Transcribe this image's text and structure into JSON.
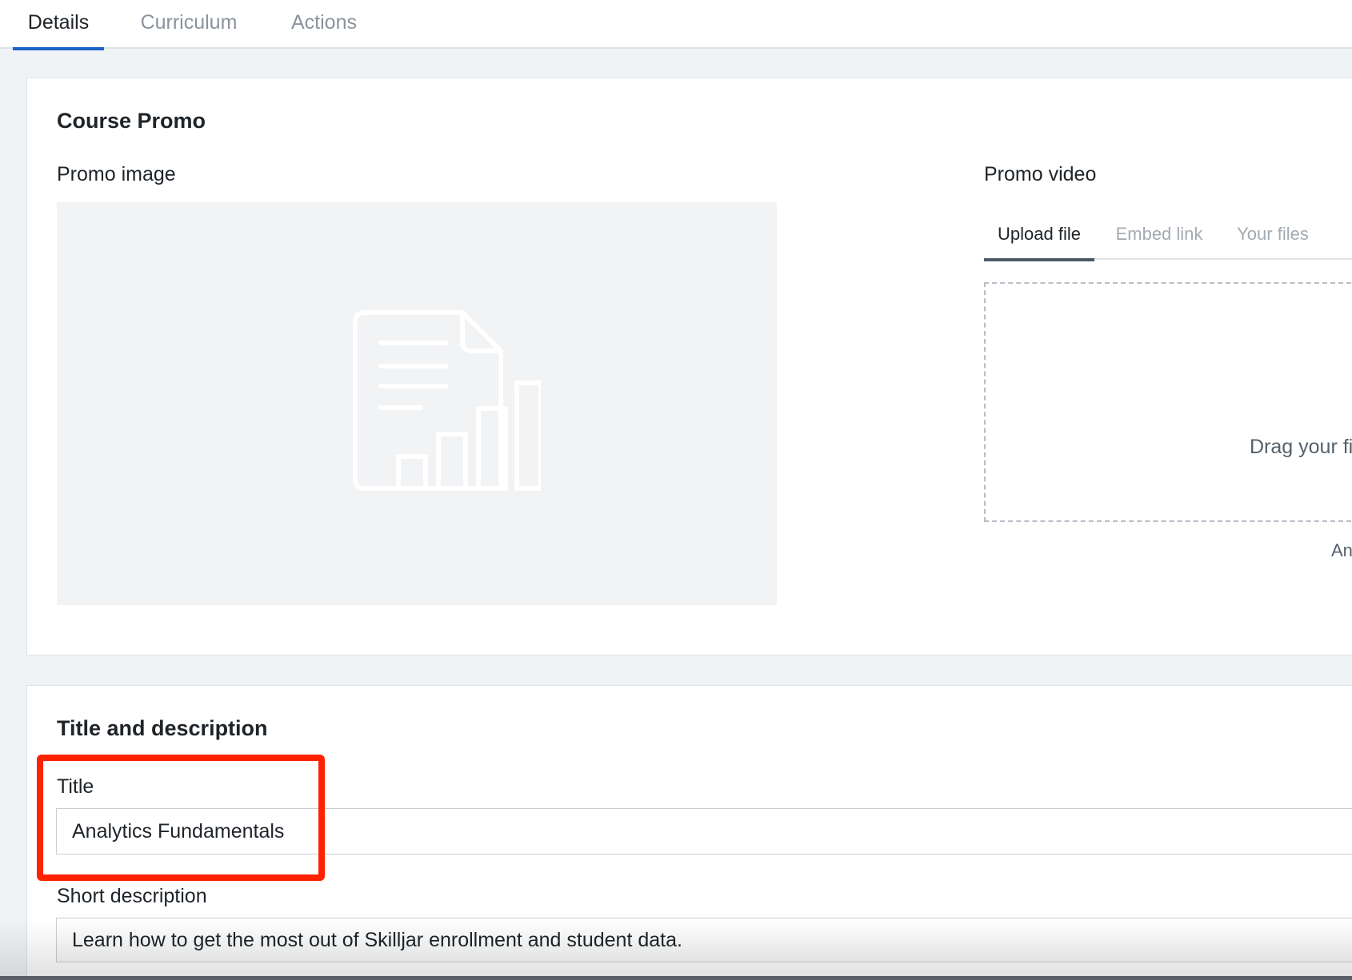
{
  "tabs": [
    {
      "label": "Details",
      "active": true
    },
    {
      "label": "Curriculum",
      "active": false
    },
    {
      "label": "Actions",
      "active": false
    }
  ],
  "course_promo": {
    "heading": "Course Promo",
    "promo_image_label": "Promo image",
    "promo_image_icon": "document-chart-icon",
    "promo_video_label": "Promo video",
    "video_tabs": [
      {
        "label": "Upload file",
        "active": true
      },
      {
        "label": "Embed link",
        "active": false
      },
      {
        "label": "Your files",
        "active": false
      }
    ],
    "dropzone_text": "Drag your fi",
    "below_dropzone_text": "An"
  },
  "title_description": {
    "heading": "Title and description",
    "title_label": "Title",
    "title_value": "Analytics Fundamentals",
    "short_description_label": "Short description",
    "short_description_value": "Learn how to get the most out of Skilljar enrollment and student data."
  },
  "colors": {
    "active_tab_indicator": "#1a63c7",
    "highlight_box": "#ff2200",
    "page_background": "#f0f3f6"
  }
}
